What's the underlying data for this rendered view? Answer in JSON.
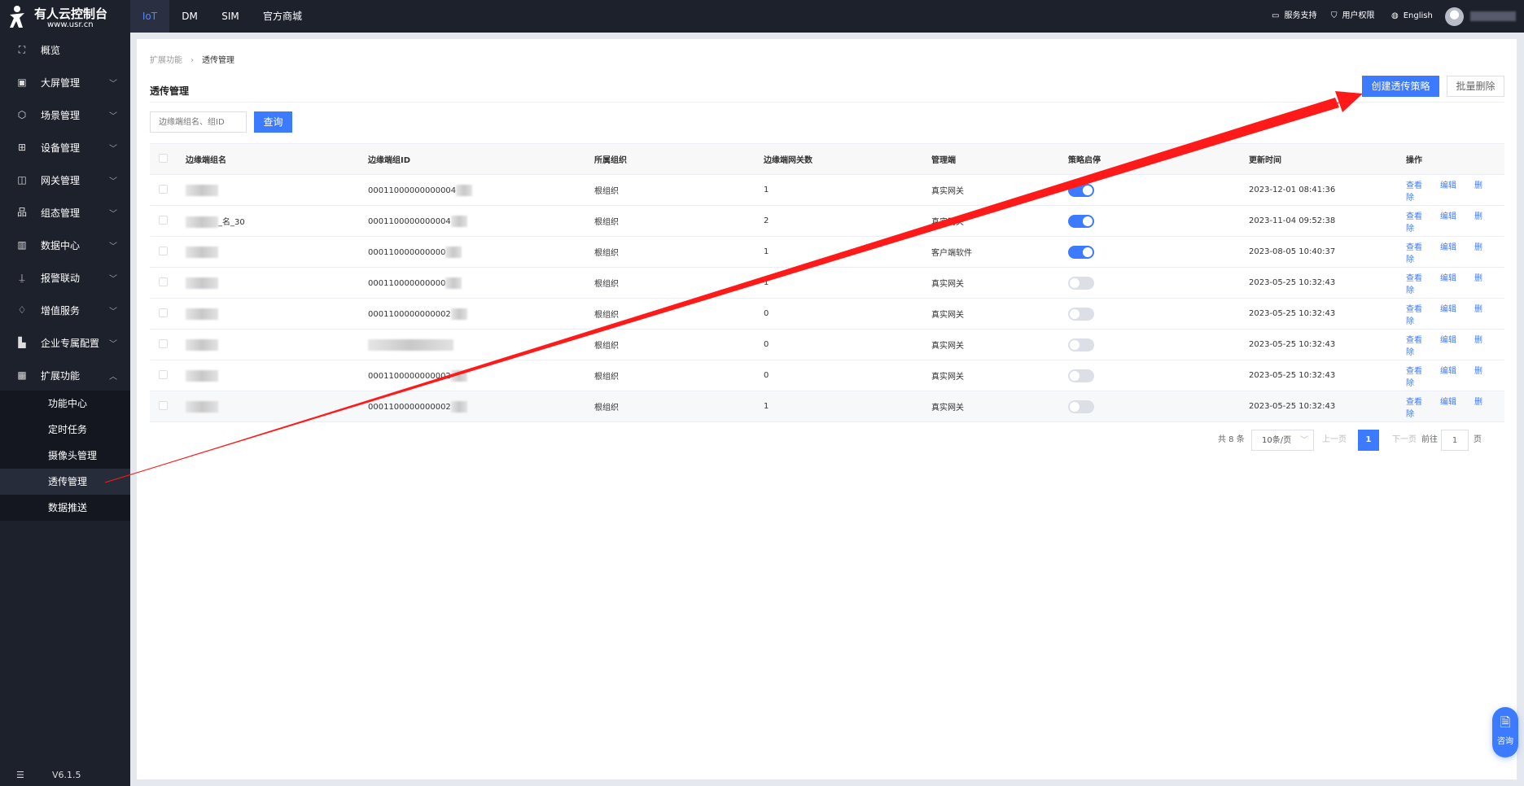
{
  "brand": {
    "name": "有人云控制台",
    "url": "www.usr.cn"
  },
  "topnav": {
    "tabs": [
      {
        "label": "IoT",
        "active": true
      },
      {
        "label": "DM"
      },
      {
        "label": "SIM"
      },
      {
        "label": "官方商城"
      }
    ],
    "support": "服务支持",
    "permissions": "用户权限",
    "language": "English"
  },
  "sidebar": {
    "items": [
      {
        "label": "概览",
        "icon": "scan-icon"
      },
      {
        "label": "大屏管理",
        "icon": "monitor-icon"
      },
      {
        "label": "场景管理",
        "icon": "cube-icon"
      },
      {
        "label": "设备管理",
        "icon": "device-icon"
      },
      {
        "label": "网关管理",
        "icon": "gateway-icon"
      },
      {
        "label": "组态管理",
        "icon": "topology-icon"
      },
      {
        "label": "数据中心",
        "icon": "bar-chart-icon"
      },
      {
        "label": "报警联动",
        "icon": "alarm-icon"
      },
      {
        "label": "增值服务",
        "icon": "diamond-icon"
      },
      {
        "label": "企业专属配置",
        "icon": "building-icon"
      },
      {
        "label": "扩展功能",
        "icon": "grid-icon",
        "expanded": true
      }
    ],
    "subitems": [
      {
        "label": "功能中心"
      },
      {
        "label": "定时任务"
      },
      {
        "label": "摄像头管理"
      },
      {
        "label": "透传管理",
        "active": true
      },
      {
        "label": "数据推送"
      }
    ],
    "version": "V6.1.5"
  },
  "breadcrumb": {
    "parent": "扩展功能",
    "current": "透传管理"
  },
  "page": {
    "title": "透传管理",
    "create_label": "创建透传策略",
    "batch_delete_label": "批量删除",
    "search_placeholder": "边缘端组名、组ID",
    "search_label": "查询"
  },
  "table": {
    "headers": [
      "边缘端组名",
      "边缘端组ID",
      "所属组织",
      "边缘端网关数",
      "管理端",
      "策略启停",
      "更新时间",
      "操作"
    ],
    "actions": [
      "查看",
      "编辑",
      "删除"
    ],
    "rows": [
      {
        "name": "",
        "id": "00011000000000004",
        "org": "根组织",
        "count": "1",
        "manager": "真实网关",
        "enabled": true,
        "updated": "2023-12-01 08:41:36"
      },
      {
        "name": "_名_30",
        "id": "0001100000000004",
        "org": "根组织",
        "count": "2",
        "manager": "真实网关",
        "enabled": true,
        "updated": "2023-11-04 09:52:38"
      },
      {
        "name": "",
        "id": "000110000000000",
        "org": "根组织",
        "count": "1",
        "manager": "客户端软件",
        "enabled": true,
        "updated": "2023-08-05 10:40:37"
      },
      {
        "name": "",
        "id": "000110000000000",
        "org": "根组织",
        "count": "1",
        "manager": "真实网关",
        "enabled": false,
        "updated": "2023-05-25 10:32:43"
      },
      {
        "name": "",
        "id": "0001100000000002",
        "org": "根组织",
        "count": "0",
        "manager": "真实网关",
        "enabled": false,
        "updated": "2023-05-25 10:32:43"
      },
      {
        "name": "",
        "id": "",
        "org": "根组织",
        "count": "0",
        "manager": "真实网关",
        "enabled": false,
        "updated": "2023-05-25 10:32:43"
      },
      {
        "name": "",
        "id": "0001100000000002",
        "org": "根组织",
        "count": "0",
        "manager": "真实网关",
        "enabled": false,
        "updated": "2023-05-25 10:32:43"
      },
      {
        "name": "",
        "id": "0001100000000002",
        "org": "根组织",
        "count": "1",
        "manager": "真实网关",
        "enabled": false,
        "updated": "2023-05-25 10:32:43"
      }
    ]
  },
  "pagination": {
    "total": "共 8 条",
    "page_size": "10条/页",
    "prev": "上一页",
    "current": "1",
    "next": "下一页",
    "goto": "前往",
    "goto_value": "1",
    "page_suffix": "页"
  },
  "consult": {
    "label": "咨询"
  },
  "colors": {
    "accent": "#3c7bff",
    "sidebar": "#1d212c",
    "annotation_arrow": "#ff1a1a"
  }
}
